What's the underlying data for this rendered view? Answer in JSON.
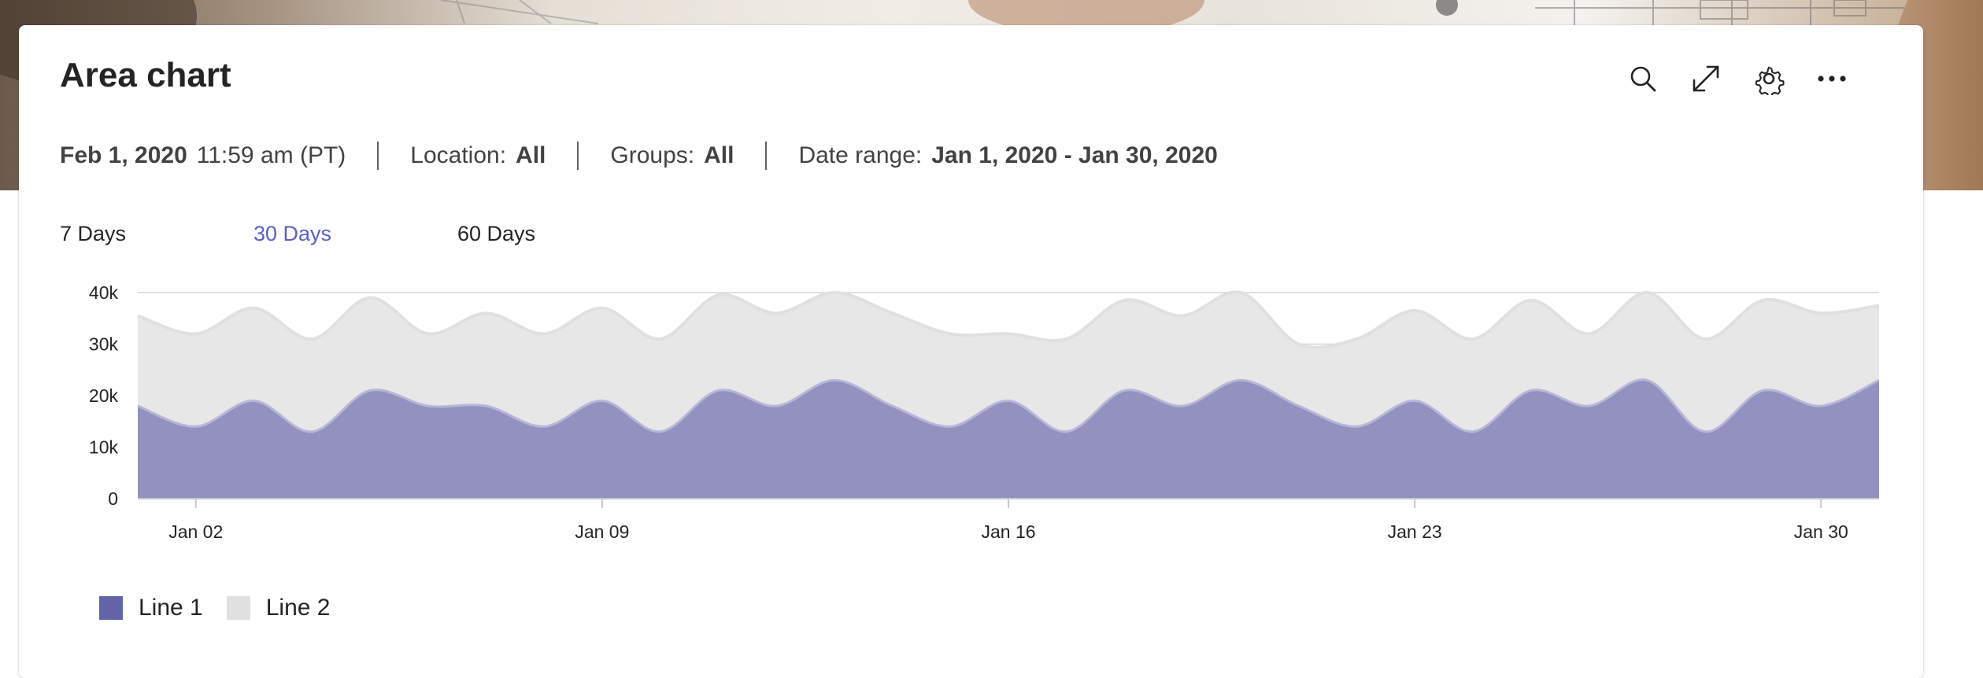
{
  "card": {
    "title": "Area chart"
  },
  "toolbar": {
    "icons": [
      "search-icon",
      "expand-icon",
      "settings-icon",
      "more-icon"
    ]
  },
  "meta": {
    "date": "Feb 1, 2020",
    "time": "11:59 am (PT)",
    "location_label": "Location:",
    "location_value": "All",
    "groups_label": "Groups:",
    "groups_value": "All",
    "date_range_label": "Date range:",
    "date_range_value": "Jan 1, 2020 - Jan 30, 2020"
  },
  "tabs": [
    {
      "label": "7 Days",
      "active": false
    },
    {
      "label": "30 Days",
      "active": true
    },
    {
      "label": "60 Days",
      "active": false
    }
  ],
  "colors": {
    "accent": "#5b5fc7",
    "line1": "#6264a7",
    "line1_fill": "#9291c0",
    "line2": "#e0e0e0",
    "line2_fill": "#e6e7e6",
    "grid": "#d6d6d6"
  },
  "chart_data": {
    "type": "area",
    "stacked": true,
    "ylim": [
      0,
      40000
    ],
    "yticks": [
      0,
      10000,
      20000,
      30000,
      40000
    ],
    "ytick_labels": [
      "0",
      "10k",
      "20k",
      "30k",
      "40k"
    ],
    "xlim": [
      "2020-01-01",
      "2020-01-31"
    ],
    "xticks": [
      "2020-01-02",
      "2020-01-09",
      "2020-01-16",
      "2020-01-23",
      "2020-01-30"
    ],
    "xtick_labels": [
      "Jan 02",
      "Jan 09",
      "Jan 16",
      "Jan 23",
      "Jan 30"
    ],
    "x": [
      "2020-01-01",
      "2020-01-02",
      "2020-01-03",
      "2020-01-04",
      "2020-01-05",
      "2020-01-06",
      "2020-01-07",
      "2020-01-08",
      "2020-01-09",
      "2020-01-10",
      "2020-01-11",
      "2020-01-12",
      "2020-01-13",
      "2020-01-14",
      "2020-01-15",
      "2020-01-16",
      "2020-01-17",
      "2020-01-18",
      "2020-01-19",
      "2020-01-20",
      "2020-01-21",
      "2020-01-22",
      "2020-01-23",
      "2020-01-24",
      "2020-01-25",
      "2020-01-26",
      "2020-01-27",
      "2020-01-28",
      "2020-01-29",
      "2020-01-30",
      "2020-01-31"
    ],
    "series": [
      {
        "name": "Line 1",
        "values": [
          18000,
          14000,
          19000,
          13000,
          21000,
          18000,
          18000,
          14000,
          19000,
          13000,
          21000,
          18000,
          23000,
          18000,
          14000,
          19000,
          13000,
          21000,
          18000,
          23000,
          18000,
          14000,
          19000,
          13000,
          21000,
          18000,
          23000,
          13000,
          21000,
          18000,
          23000
        ]
      },
      {
        "name": "Line 2",
        "values": [
          35500,
          32000,
          37000,
          31000,
          39000,
          32000,
          36000,
          32000,
          37000,
          31000,
          39500,
          36000,
          40000,
          36000,
          32000,
          32000,
          31000,
          38500,
          35500,
          40000,
          30000,
          31000,
          36500,
          31000,
          38500,
          32000,
          40000,
          31000,
          38500,
          36000,
          37500
        ]
      }
    ],
    "legend": [
      "Line 1",
      "Line 2"
    ],
    "grid": true,
    "legend_position": "bottom-left"
  }
}
